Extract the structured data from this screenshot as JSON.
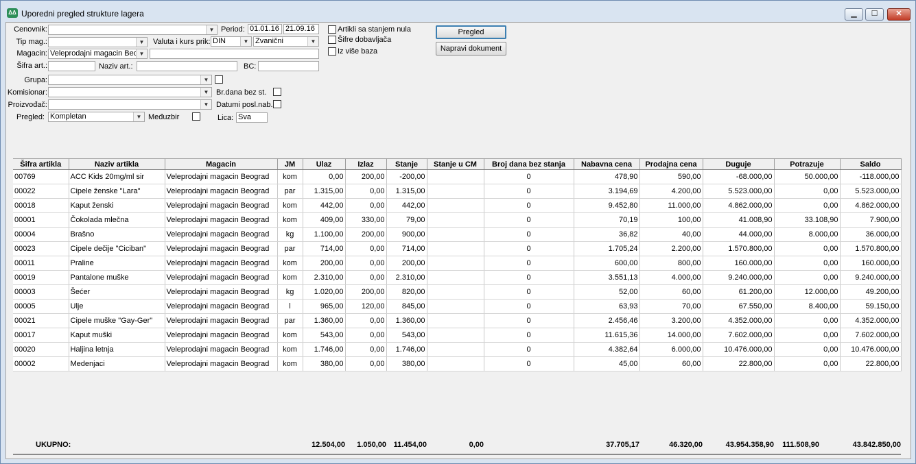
{
  "window": {
    "title": "Uporedni pregled strukture lagera",
    "icon": "app-logo-icon",
    "controls": {
      "minimize": "▁",
      "maximize": "☐",
      "close": "✕"
    }
  },
  "filters": {
    "cenovnik": {
      "label": "Cenovnik:",
      "value": ""
    },
    "period": {
      "label": "Period:",
      "from": "01.01.16",
      "to": "21.09.16"
    },
    "tip_mag": {
      "label": "Tip mag.:",
      "value": ""
    },
    "valuta": {
      "label": "Valuta i kurs prik:",
      "currency": "DIN",
      "rate": "Zvanični"
    },
    "magacin": {
      "label": "Magacin:",
      "value": "Veleprodajni magacin Beo",
      "extra": ""
    },
    "sifra_art": {
      "label": "Šifra art.:",
      "value": ""
    },
    "naziv_art": {
      "label": "Naziv art.:",
      "value": ""
    },
    "bc": {
      "label": "BC:",
      "value": ""
    },
    "grupa": {
      "label": "Grupa:",
      "value": ""
    },
    "komisionar": {
      "label": "Komisionar:",
      "value": ""
    },
    "br_dana": {
      "label": "Br.dana bez st."
    },
    "proizvodjac": {
      "label": "Proizvođač:",
      "value": ""
    },
    "datumi": {
      "label": "Datumi posl.nab."
    },
    "pregled": {
      "label": "Pregled:",
      "value": "Kompletan"
    },
    "medjuzbir": {
      "label": "Međuzbir"
    },
    "lica": {
      "label": "Lica:",
      "value": "Sva"
    },
    "checks": {
      "nula": "Artikli sa stanjem nula",
      "sifre": "Šifre dobavljača",
      "vise_baza": "Iz više baza"
    }
  },
  "buttons": {
    "pregled": "Pregled",
    "napravi": "Napravi dokument"
  },
  "table": {
    "columns": [
      "Šifra artikla",
      "Naziv artikla",
      "Magacin",
      "JM",
      "Ulaz",
      "Izlaz",
      "Stanje",
      "Stanje u CM",
      "Broj dana bez stanja",
      "Nabavna cena",
      "Prodajna cena",
      "Duguje",
      "Potrazuje",
      "Saldo"
    ],
    "rows": [
      [
        "00769",
        "ACC Kids 20mg/ml sir",
        "Veleprodajni magacin Beograd",
        "kom",
        "0,00",
        "200,00",
        "-200,00",
        "",
        "0",
        "478,90",
        "590,00",
        "-68.000,00",
        "50.000,00",
        "-118.000,00"
      ],
      [
        "00022",
        "Cipele ženske \"Lara\"",
        "Veleprodajni magacin Beograd",
        "par",
        "1.315,00",
        "0,00",
        "1.315,00",
        "",
        "0",
        "3.194,69",
        "4.200,00",
        "5.523.000,00",
        "0,00",
        "5.523.000,00"
      ],
      [
        "00018",
        "Kaput ženski",
        "Veleprodajni magacin Beograd",
        "kom",
        "442,00",
        "0,00",
        "442,00",
        "",
        "0",
        "9.452,80",
        "11.000,00",
        "4.862.000,00",
        "0,00",
        "4.862.000,00"
      ],
      [
        "00001",
        "Čokolada mlečna",
        "Veleprodajni magacin Beograd",
        "kom",
        "409,00",
        "330,00",
        "79,00",
        "",
        "0",
        "70,19",
        "100,00",
        "41.008,90",
        "33.108,90",
        "7.900,00"
      ],
      [
        "00004",
        "Brašno",
        "Veleprodajni magacin Beograd",
        "kg",
        "1.100,00",
        "200,00",
        "900,00",
        "",
        "0",
        "36,82",
        "40,00",
        "44.000,00",
        "8.000,00",
        "36.000,00"
      ],
      [
        "00023",
        "Cipele dečije \"Ciciban\"",
        "Veleprodajni magacin Beograd",
        "par",
        "714,00",
        "0,00",
        "714,00",
        "",
        "0",
        "1.705,24",
        "2.200,00",
        "1.570.800,00",
        "0,00",
        "1.570.800,00"
      ],
      [
        "00011",
        "Praline",
        "Veleprodajni magacin Beograd",
        "kom",
        "200,00",
        "0,00",
        "200,00",
        "",
        "0",
        "600,00",
        "800,00",
        "160.000,00",
        "0,00",
        "160.000,00"
      ],
      [
        "00019",
        "Pantalone muške",
        "Veleprodajni magacin Beograd",
        "kom",
        "2.310,00",
        "0,00",
        "2.310,00",
        "",
        "0",
        "3.551,13",
        "4.000,00",
        "9.240.000,00",
        "0,00",
        "9.240.000,00"
      ],
      [
        "00003",
        "Šećer",
        "Veleprodajni magacin Beograd",
        "kg",
        "1.020,00",
        "200,00",
        "820,00",
        "",
        "0",
        "52,00",
        "60,00",
        "61.200,00",
        "12.000,00",
        "49.200,00"
      ],
      [
        "00005",
        "Ulje",
        "Veleprodajni magacin Beograd",
        "l",
        "965,00",
        "120,00",
        "845,00",
        "",
        "0",
        "63,93",
        "70,00",
        "67.550,00",
        "8.400,00",
        "59.150,00"
      ],
      [
        "00021",
        "Cipele muške \"Gay-Ger\"",
        "Veleprodajni magacin Beograd",
        "par",
        "1.360,00",
        "0,00",
        "1.360,00",
        "",
        "0",
        "2.456,46",
        "3.200,00",
        "4.352.000,00",
        "0,00",
        "4.352.000,00"
      ],
      [
        "00017",
        "Kaput muški",
        "Veleprodajni magacin Beograd",
        "kom",
        "543,00",
        "0,00",
        "543,00",
        "",
        "0",
        "11.615,36",
        "14.000,00",
        "7.602.000,00",
        "0,00",
        "7.602.000,00"
      ],
      [
        "00020",
        "Haljina letnja",
        "Veleprodajni magacin Beograd",
        "kom",
        "1.746,00",
        "0,00",
        "1.746,00",
        "",
        "0",
        "4.382,64",
        "6.000,00",
        "10.476.000,00",
        "0,00",
        "10.476.000,00"
      ],
      [
        "00002",
        "Medenjaci",
        "Veleprodajni magacin Beograd",
        "kom",
        "380,00",
        "0,00",
        "380,00",
        "",
        "0",
        "45,00",
        "60,00",
        "22.800,00",
        "0,00",
        "22.800,00"
      ]
    ]
  },
  "totals": {
    "label": "UKUPNO:",
    "ulaz": "12.504,00",
    "izlaz": "1.050,00",
    "stanje": "11.454,00",
    "stanje_cm": "0,00",
    "nabavna": "37.705,17",
    "prodajna": "46.320,00",
    "duguje": "43.954.358,90",
    "potrazuje": "111.508,90",
    "saldo": "43.842.850,00"
  }
}
